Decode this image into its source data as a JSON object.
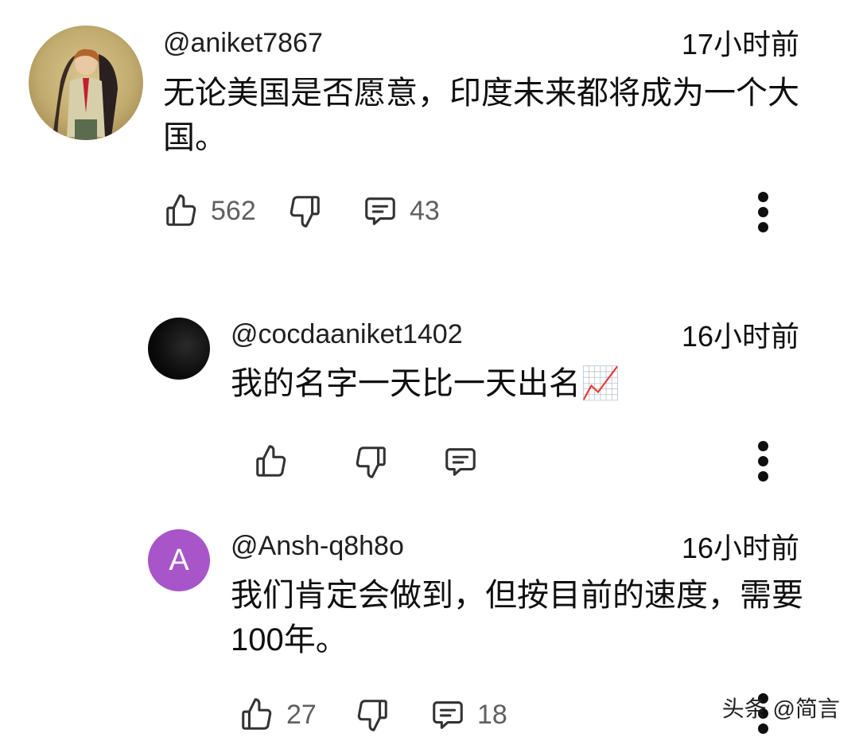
{
  "comments": [
    {
      "username": "@aniket7867",
      "time": "17小时前",
      "text": "无论美国是否愿意，印度未来都将成为一个大国。",
      "likes": "562",
      "replies": "43"
    },
    {
      "username": "@cocdaaniket1402",
      "time": "16小时前",
      "text": "我的名字一天比一天出名",
      "emoji": "📈",
      "likes": "",
      "replies": ""
    },
    {
      "username": "@Ansh-q8h8o",
      "time": "16小时前",
      "avatar_letter": "A",
      "avatar_color": "#a855c9",
      "text": "我们肯定会做到，但按目前的速度，需要100年。",
      "likes": "27",
      "replies": "18"
    }
  ],
  "icons": {
    "like": "thumbs-up-icon",
    "dislike": "thumbs-down-icon",
    "reply": "reply-comment-icon",
    "more": "more-vertical-icon"
  },
  "watermark": "头条 @简言"
}
